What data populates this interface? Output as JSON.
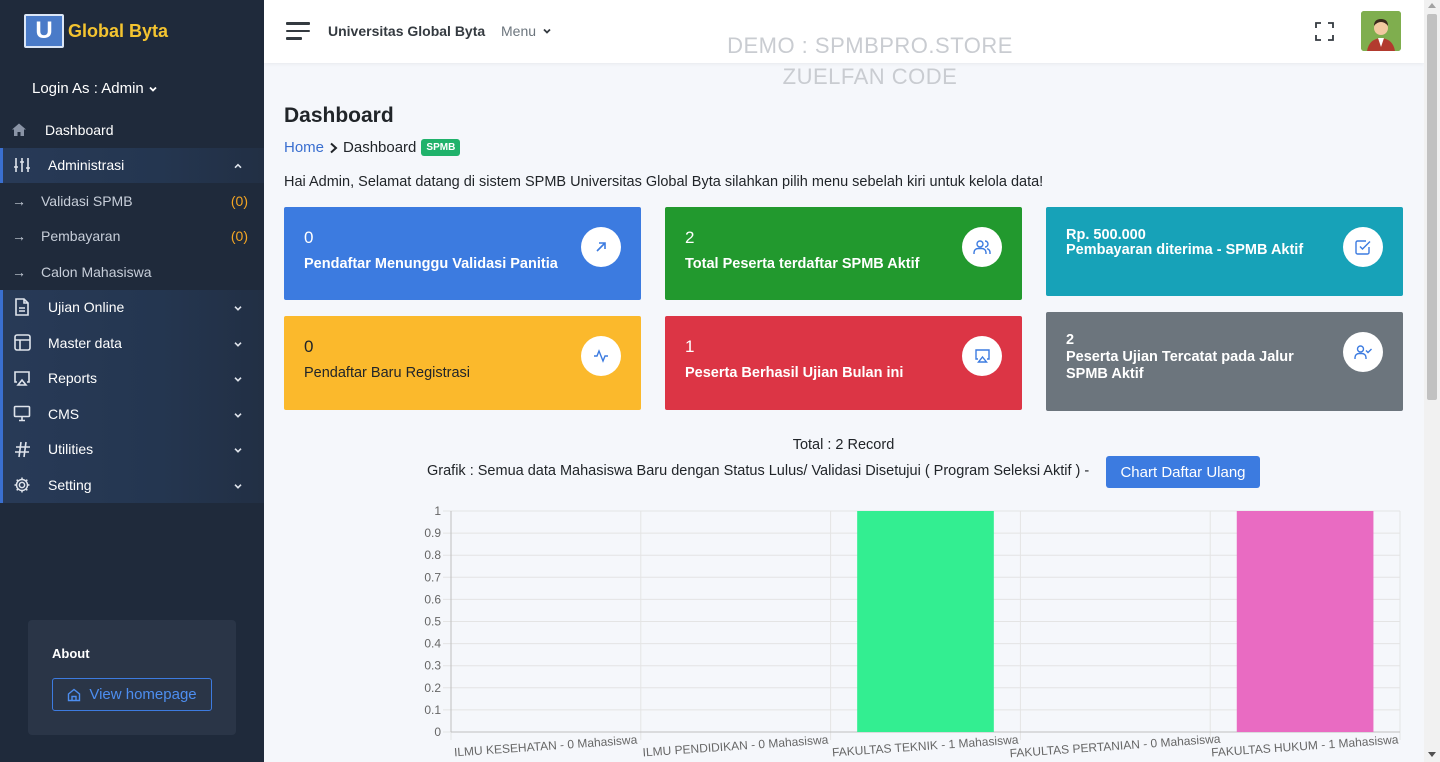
{
  "sidebar": {
    "brand_letter": "U",
    "brand_name": "Global Byta",
    "login_as": "Login As : Admin",
    "items": [
      {
        "label": "Dashboard",
        "icon": "home-icon"
      },
      {
        "label": "Administrasi",
        "icon": "sliders-icon"
      },
      {
        "label": "Validasi SPMB",
        "count": "(0)"
      },
      {
        "label": "Pembayaran",
        "count": "(0)"
      },
      {
        "label": "Calon Mahasiswa"
      },
      {
        "label": "Ujian Online",
        "icon": "file-icon"
      },
      {
        "label": "Master data",
        "icon": "layout-icon"
      },
      {
        "label": "Reports",
        "icon": "airplay-icon"
      },
      {
        "label": "CMS",
        "icon": "monitor-icon"
      },
      {
        "label": "Utilities",
        "icon": "hash-icon"
      },
      {
        "label": "Setting",
        "icon": "gear-icon"
      }
    ],
    "about_title": "About",
    "view_homepage": "View homepage"
  },
  "topbar": {
    "title": "Universitas Global Byta",
    "menu": "Menu",
    "watermark_line1": "DEMO : SPMBPRO.STORE",
    "watermark_line2": "ZUELFAN CODE"
  },
  "main": {
    "page_title": "Dashboard",
    "breadcrumb_home": "Home",
    "breadcrumb_current": "Dashboard",
    "breadcrumb_badge": "SPMB",
    "welcome": "Hai Admin, Selamat datang di sistem SPMB Universitas Global Byta silahkan pilih menu sebelah kiri untuk kelola data!",
    "cards": [
      {
        "value": "0",
        "label": "Pendaftar Menunggu Validasi Panitia",
        "color": "#3c7be0",
        "icon": "arrow-up-right-icon"
      },
      {
        "value": "2",
        "label": "Total Peserta terdaftar SPMB Aktif",
        "color": "#22992e",
        "icon": "users-icon"
      },
      {
        "value": "Rp. 500.000",
        "label": "Pembayaran diterima - SPMB Aktif",
        "color": "#17a2b8",
        "icon": "check-square-icon"
      },
      {
        "value": "0",
        "label": "Pendaftar Baru Registrasi",
        "color": "#fbb92c",
        "icon": "activity-icon"
      },
      {
        "value": "1",
        "label": "Peserta Berhasil Ujian Bulan ini",
        "color": "#dc3545",
        "icon": "airplay-icon"
      },
      {
        "value": "2",
        "label": "Peserta Ujian Tercatat pada Jalur SPMB Aktif",
        "color": "#6c757d",
        "icon": "user-check-icon"
      }
    ],
    "chart_total": "Total : 2 Record",
    "chart_subtitle": "Grafik : Semua data Mahasiswa Baru dengan Status Lulus/ Validasi Disetujui ( Program Seleksi Aktif ) -",
    "chart_button": "Chart Daftar Ulang"
  },
  "chart_data": {
    "type": "bar",
    "categories": [
      "ILMU KESEHATAN  - 0 Mahasiswa",
      "ILMU PENDIDIKAN  - 0 Mahasiswa",
      "FAKULTAS TEKNIK  - 1 Mahasiswa",
      "FAKULTAS PERTANIAN  - 0 Mahasiswa",
      "FAKULTAS HUKUM  - 1 Mahasiswa"
    ],
    "values": [
      0,
      0,
      1,
      0,
      1
    ],
    "colors": [
      "#36a2eb",
      "#ff9f40",
      "#33ee91",
      "#9966ff",
      "#e96bc2"
    ],
    "ylim": [
      0,
      1
    ],
    "yticks": [
      "0",
      "0.1",
      "0.2",
      "0.3",
      "0.4",
      "0.5",
      "0.6",
      "0.7",
      "0.8",
      "0.9",
      "1"
    ],
    "grid": true
  }
}
